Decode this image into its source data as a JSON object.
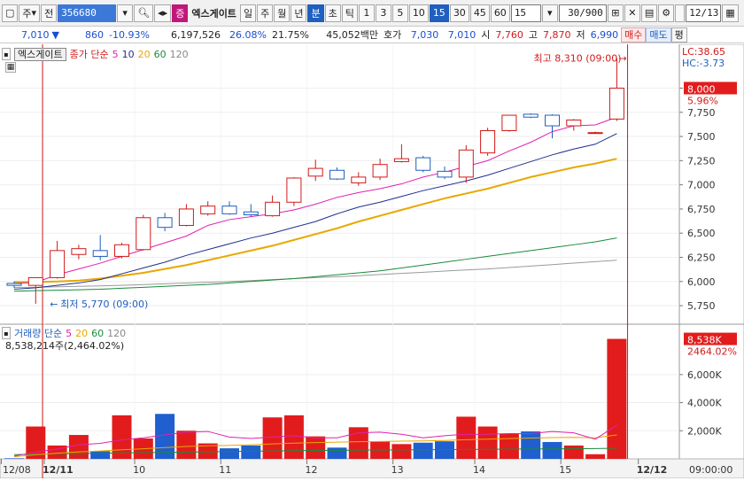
{
  "toolbar": {
    "market": "주",
    "full_label": "전",
    "code": "356680",
    "stock_flag": "증",
    "stock_name": "엑스게이트",
    "periods": [
      "일",
      "주",
      "월",
      "년",
      "분",
      "초",
      "틱"
    ],
    "period_selected": "분",
    "intervals": [
      "1",
      "3",
      "5",
      "10",
      "15",
      "30",
      "45",
      "60"
    ],
    "interval_selected": "15",
    "interval_combo": "15",
    "count": "30/900",
    "date_value": "12/13"
  },
  "quote": {
    "price": "7,010",
    "change": "860",
    "change_rate": "-10.93%",
    "volume": "6,197,526",
    "rate1": "26.08%",
    "rate2": "21.75%",
    "amount": "45,052백만",
    "ask_label": "호가",
    "ask1": "7,030",
    "ask2": "7,010",
    "open_label": "시",
    "open": "7,760",
    "high_label": "고",
    "high": "7,870",
    "low_label": "저",
    "low": "6,990",
    "buy_btn": "매수",
    "sell_btn": "매도",
    "extra_btn": "평"
  },
  "price_legend": {
    "name": "엑스게이트",
    "title": "종가 단순",
    "ma": [
      "5",
      "10",
      "20",
      "60",
      "120"
    ],
    "ma_colors": [
      "#e020b0",
      "#1f2f8f",
      "#e8a800",
      "#1a8a3a",
      "#888888"
    ]
  },
  "volume_legend": {
    "title": "거래량 단순",
    "ma": [
      "5",
      "20",
      "60",
      "120"
    ],
    "ma_colors": [
      "#e020b0",
      "#e8a800",
      "#1a8a3a",
      "#888888"
    ],
    "value": "8,538,214주(2,464.02%)"
  },
  "annotations": {
    "high": "최고 8,310 (09:00)",
    "low": "최저 5,770 (09:00)",
    "lc": "LC:38.65",
    "hc": "HC:-3.73",
    "current_price": "8,000",
    "current_pct": "5.96%",
    "current_vol": "8,538K",
    "current_vol_pct": "2464.02%"
  },
  "x_labels": [
    "12/08",
    "12/11",
    "10",
    "11",
    "12",
    "13",
    "14",
    "15",
    "12/12",
    "09:00:00"
  ],
  "chart_data": {
    "type": "candlestick",
    "interval": "15min",
    "ylim": [
      5650,
      8380
    ],
    "y_ticks": [
      "8,000",
      "7,750",
      "7,500",
      "7,250",
      "7,000",
      "6,750",
      "6,500",
      "6,250",
      "6,000",
      "5,750"
    ],
    "y_tick_values": [
      8000,
      7750,
      7500,
      7250,
      7000,
      6750,
      6500,
      6250,
      6000,
      5750
    ],
    "candles": [
      {
        "o": 5980,
        "h": 6000,
        "l": 5930,
        "c": 5960
      },
      {
        "o": 5960,
        "h": 6030,
        "l": 5770,
        "c": 6040
      },
      {
        "o": 6040,
        "h": 6420,
        "l": 6030,
        "c": 6320
      },
      {
        "o": 6280,
        "h": 6380,
        "l": 6230,
        "c": 6340
      },
      {
        "o": 6320,
        "h": 6480,
        "l": 6220,
        "c": 6260
      },
      {
        "o": 6260,
        "h": 6400,
        "l": 6240,
        "c": 6380
      },
      {
        "o": 6330,
        "h": 6690,
        "l": 6320,
        "c": 6660
      },
      {
        "o": 6660,
        "h": 6710,
        "l": 6520,
        "c": 6560
      },
      {
        "o": 6580,
        "h": 6800,
        "l": 6570,
        "c": 6750
      },
      {
        "o": 6700,
        "h": 6830,
        "l": 6680,
        "c": 6780
      },
      {
        "o": 6780,
        "h": 6830,
        "l": 6690,
        "c": 6700
      },
      {
        "o": 6720,
        "h": 6800,
        "l": 6670,
        "c": 6690
      },
      {
        "o": 6680,
        "h": 6890,
        "l": 6670,
        "c": 6820
      },
      {
        "o": 6820,
        "h": 7080,
        "l": 6780,
        "c": 7070
      },
      {
        "o": 7090,
        "h": 7260,
        "l": 7040,
        "c": 7170
      },
      {
        "o": 7150,
        "h": 7180,
        "l": 7050,
        "c": 7060
      },
      {
        "o": 7020,
        "h": 7130,
        "l": 6990,
        "c": 7080
      },
      {
        "o": 7080,
        "h": 7270,
        "l": 7050,
        "c": 7210
      },
      {
        "o": 7240,
        "h": 7420,
        "l": 7230,
        "c": 7270
      },
      {
        "o": 7280,
        "h": 7300,
        "l": 7130,
        "c": 7150
      },
      {
        "o": 7140,
        "h": 7190,
        "l": 7060,
        "c": 7080
      },
      {
        "o": 7080,
        "h": 7410,
        "l": 7020,
        "c": 7360
      },
      {
        "o": 7330,
        "h": 7590,
        "l": 7300,
        "c": 7560
      },
      {
        "o": 7560,
        "h": 7720,
        "l": 7550,
        "c": 7720
      },
      {
        "o": 7730,
        "h": 7740,
        "l": 7690,
        "c": 7700
      },
      {
        "o": 7720,
        "h": 7730,
        "l": 7480,
        "c": 7610
      },
      {
        "o": 7610,
        "h": 7680,
        "l": 7560,
        "c": 7670
      },
      {
        "o": 7540,
        "h": 7550,
        "l": 7530,
        "c": 7540
      },
      {
        "o": 7680,
        "h": 8310,
        "l": 7660,
        "c": 8000
      }
    ],
    "ma5": [
      5980,
      5990,
      6070,
      6130,
      6190,
      6260,
      6330,
      6400,
      6470,
      6580,
      6640,
      6670,
      6700,
      6740,
      6800,
      6870,
      6920,
      6960,
      7010,
      7080,
      7130,
      7190,
      7250,
      7350,
      7440,
      7550,
      7610,
      7620,
      7700
    ],
    "ma10": [
      5920,
      5935,
      5960,
      5985,
      6020,
      6080,
      6140,
      6200,
      6270,
      6330,
      6390,
      6450,
      6500,
      6560,
      6620,
      6700,
      6770,
      6820,
      6880,
      6940,
      6990,
      7040,
      7100,
      7170,
      7240,
      7310,
      7370,
      7420,
      7530
    ],
    "ma20": [
      5995,
      5995,
      6000,
      6010,
      6030,
      6060,
      6090,
      6130,
      6170,
      6220,
      6270,
      6320,
      6370,
      6430,
      6490,
      6550,
      6620,
      6680,
      6740,
      6800,
      6860,
      6910,
      6960,
      7020,
      7080,
      7130,
      7180,
      7220,
      7270
    ],
    "ma60": [
      5900,
      5905,
      5910,
      5915,
      5920,
      5930,
      5940,
      5950,
      5960,
      5970,
      5985,
      6000,
      6015,
      6030,
      6050,
      6070,
      6090,
      6110,
      6140,
      6170,
      6200,
      6230,
      6260,
      6290,
      6320,
      6350,
      6380,
      6410,
      6450
    ],
    "ma120": [
      5940,
      5940,
      5945,
      5950,
      5955,
      5960,
      5968,
      5976,
      5984,
      5992,
      6000,
      6010,
      6020,
      6030,
      6040,
      6050,
      6060,
      6072,
      6084,
      6096,
      6108,
      6120,
      6130,
      6145,
      6160,
      6175,
      6190,
      6205,
      6220
    ],
    "volume_ylim": [
      0,
      8700
    ],
    "volume_ticks": [
      "6,000K",
      "4,000K",
      "2,000K"
    ],
    "volume_tick_values": [
      6000,
      4000,
      2000
    ],
    "volume": [
      40,
      2300,
      950,
      1700,
      550,
      3100,
      1450,
      3200,
      2000,
      1100,
      750,
      950,
      2950,
      3100,
      1600,
      800,
      2250,
      1250,
      1050,
      1150,
      1250,
      3000,
      2300,
      1800,
      1950,
      1200,
      950,
      330,
      8538
    ],
    "volume_ma5": [
      200,
      480,
      700,
      1000,
      1100,
      1350,
      1500,
      1700,
      1900,
      1950,
      1550,
      1450,
      1550,
      1650,
      1500,
      1500,
      1850,
      1900,
      1750,
      1500,
      1650,
      1750,
      1750,
      1800,
      1800,
      1950,
      1850,
      1400,
      2400
    ],
    "volume_ma20": [
      150,
      300,
      400,
      500,
      560,
      650,
      720,
      800,
      880,
      930,
      960,
      1000,
      1060,
      1120,
      1160,
      1190,
      1220,
      1240,
      1260,
      1280,
      1310,
      1360,
      1400,
      1440,
      1480,
      1510,
      1530,
      1500,
      1700
    ],
    "volume_ma60": [
      300,
      330,
      360,
      380,
      400,
      420,
      440,
      460,
      480,
      500,
      520,
      540,
      560,
      580,
      600,
      610,
      620,
      630,
      640,
      650,
      660,
      670,
      680,
      690,
      700,
      710,
      720,
      730,
      760
    ]
  },
  "colors": {
    "up": "#d21a1a",
    "down": "#1f5fbf",
    "axis_bg": "#e9eef7",
    "accent": "#1f5fbf"
  }
}
